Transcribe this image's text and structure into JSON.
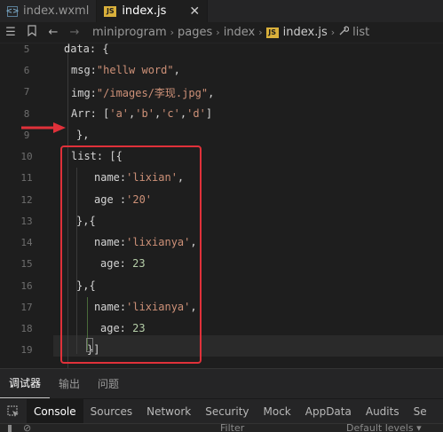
{
  "tabs": [
    {
      "label": "index.wxml",
      "icon": "wxml-file-icon",
      "active": false
    },
    {
      "label": "index.js",
      "icon": "js-file-icon",
      "active": true
    }
  ],
  "tab_close_glyph": "✕",
  "breadcrumb": {
    "items": [
      "miniprogram",
      "pages",
      "index"
    ],
    "file": "index.js",
    "symbol": "list",
    "js_badge": "JS"
  },
  "line_numbers": [
    "5",
    "6",
    "7",
    "8",
    "9",
    "10",
    "11",
    "12",
    "13",
    "14",
    "15",
    "16",
    "17",
    "18",
    "19"
  ],
  "code": {
    "l5": "data: {",
    "l6_key": "msg:",
    "l6_val": "\"hellw word\"",
    "l6_end": ",",
    "l7_key": "img:",
    "l7_val": "\"/images/李现.jpg\"",
    "l7_end": ",",
    "l8_key": "Arr: [",
    "l8_a": "'a'",
    "l8_b": "'b'",
    "l8_c": "'c'",
    "l8_d": "'d'",
    "l8_end": "]",
    "l9": "},",
    "l10": "list: [{",
    "l11_key": "name:",
    "l11_val": "'lixian'",
    "l11_end": ",",
    "l12_key": "age :",
    "l12_val": "'20'",
    "l13": "},{",
    "l14_key": "name:",
    "l14_val": "'lixianya'",
    "l14_end": ",",
    "l15_key": "age: ",
    "l15_val": "23",
    "l16": "},{",
    "l17_key": "name:",
    "l17_val": "'lixianya'",
    "l17_end": ",",
    "l18_key": "age: ",
    "l18_val": "23",
    "l19": "}]"
  },
  "panel_tabs": [
    "调试器",
    "输出",
    "问题"
  ],
  "devtools_tabs": [
    "Console",
    "Sources",
    "Network",
    "Security",
    "Mock",
    "AppData",
    "Audits",
    "Se"
  ],
  "filter": {
    "placeholder": "Filter",
    "levels": "Default levels ▾"
  },
  "colors": {
    "annotation": "#e0313a",
    "string": "#ce9178",
    "number": "#b5cea8",
    "js_badge": "#d9b03b"
  }
}
